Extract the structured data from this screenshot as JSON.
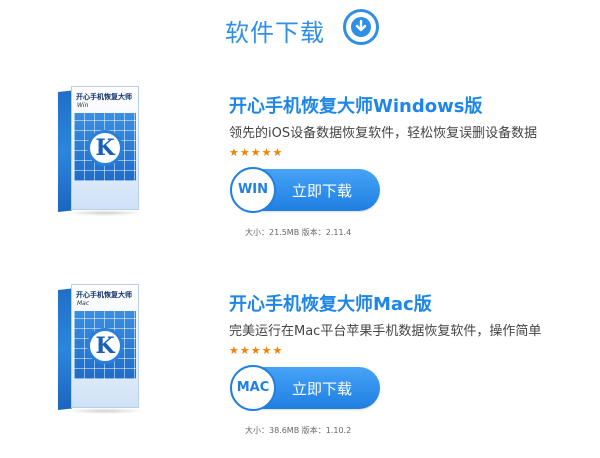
{
  "header": {
    "title": "软件下载",
    "icon": "download-circle-icon",
    "accent": "#2f8fe6"
  },
  "products": [
    {
      "box_name": "开心手机恢复大师",
      "box_platform": "Win",
      "box_logo": "K",
      "title": "开心手机恢复大师Windows版",
      "description": "领先的iOS设备数据恢复软件，轻松恢复误删设备数据",
      "stars": "★★★★★",
      "badge": "WIN",
      "button_label": "立即下载",
      "meta": "大小：21.5MB  版本：2.11.4"
    },
    {
      "box_name": "开心手机恢复大师",
      "box_platform": "Mac",
      "box_logo": "K",
      "title": "开心手机恢复大师Mac版",
      "description": "完美运行在Mac平台苹果手机数据恢复软件，操作简单",
      "stars": "★★★★★",
      "badge": "MAC",
      "button_label": "立即下载",
      "meta": "大小：38.6MB  版本：1.10.2"
    }
  ]
}
